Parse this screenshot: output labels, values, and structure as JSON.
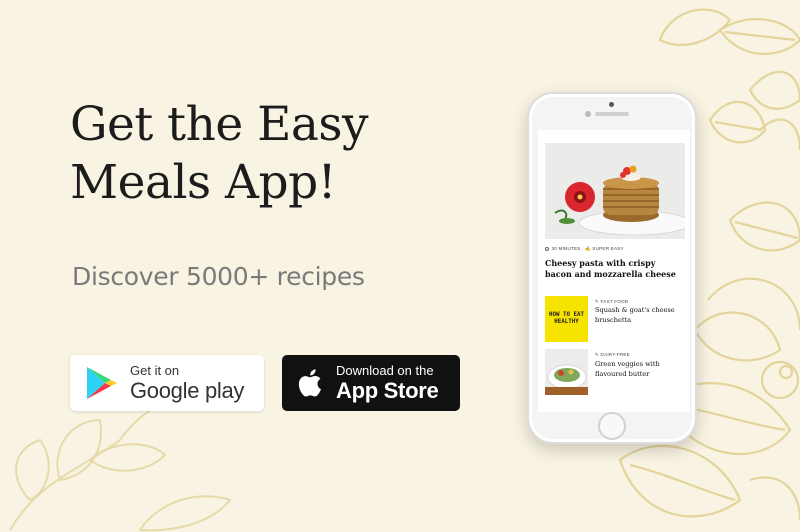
{
  "headline": "Get the Easy Meals App!",
  "subtitle": "Discover 5000+ recipes",
  "google_play": {
    "small": "Get it on",
    "big": "Google play"
  },
  "app_store": {
    "small": "Download on the",
    "big": "App Store"
  },
  "phone": {
    "featured": {
      "time": "30 MINUTES",
      "difficulty": "SUPER EASY",
      "title": "Cheesy pasta with crispy bacon and mozzarella cheese"
    },
    "items": [
      {
        "tag": "FAST FOOD",
        "title": "Squash & goat's cheese bruschetta",
        "thumb_text": "HOW TO EAT HEALTHY"
      },
      {
        "tag": "DAIRY-FREE",
        "title": "Green veggies with flavoured butter"
      }
    ]
  },
  "colors": {
    "background": "#f8f3e2",
    "decor": "#e8dcaa",
    "apple_button": "#111111"
  }
}
